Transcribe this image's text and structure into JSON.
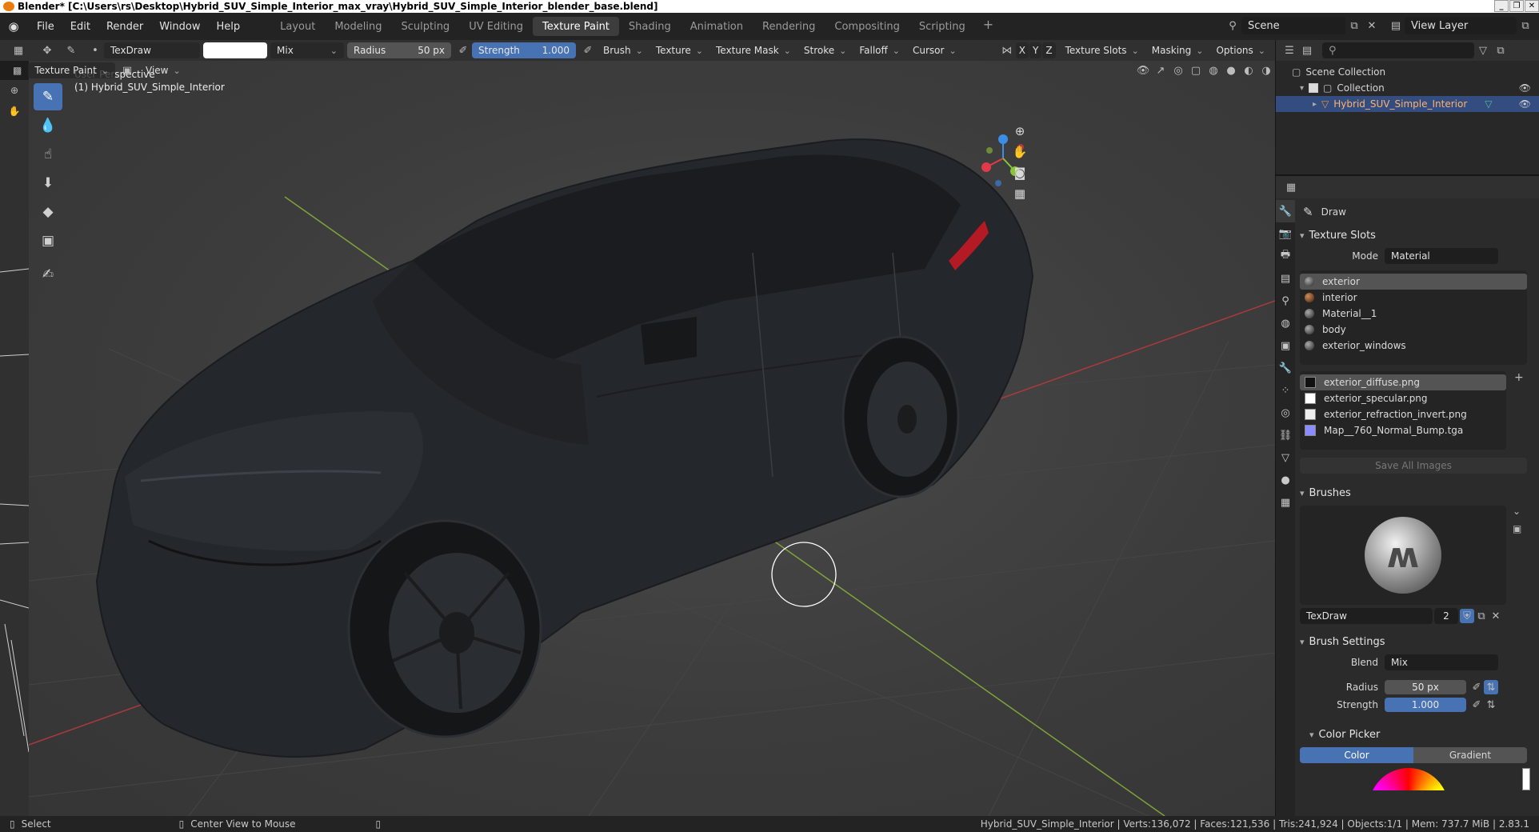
{
  "window": {
    "title": "Blender* [C:\\Users\\rs\\Desktop\\Hybrid_SUV_Simple_Interior_max_vray\\Hybrid_SUV_Simple_Interior_blender_base.blend]",
    "controls": [
      "_",
      "❐",
      "✕"
    ]
  },
  "menu": {
    "items": [
      "File",
      "Edit",
      "Render",
      "Window",
      "Help"
    ]
  },
  "workspaces": {
    "tabs": [
      "Layout",
      "Modeling",
      "Sculpting",
      "UV Editing",
      "Texture Paint",
      "Shading",
      "Animation",
      "Rendering",
      "Compositing",
      "Scripting"
    ],
    "active": "Texture Paint",
    "add": "+"
  },
  "scene": {
    "name": "Scene",
    "view_layer": "View Layer"
  },
  "tool_header": {
    "brush_name": "TexDraw",
    "blend_mode": "Mix",
    "radius_label": "Radius",
    "radius_value": "50 px",
    "strength_label": "Strength",
    "strength_value": "1.000",
    "strength_fill": 1.0,
    "dropdowns": [
      "Brush",
      "Texture",
      "Texture Mask",
      "Stroke",
      "Falloff",
      "Cursor"
    ],
    "axes": [
      "X",
      "Y",
      "Z"
    ],
    "right_dropdowns": [
      "Texture Slots",
      "Masking",
      "Options"
    ]
  },
  "sub_header": {
    "mode": "Texture Paint",
    "view": "View"
  },
  "viewport": {
    "perspective": "User Perspective",
    "object_label": "(1) Hybrid_SUV_Simple_Interior",
    "gizmo": {
      "x": "X",
      "y": "Y",
      "z": "Z"
    },
    "colors": {
      "x_axis": "#e33a49",
      "y_axis": "#8ac43a",
      "z_axis": "#3c8de8",
      "car_body": "#23262a",
      "tail_light": "#b31a24"
    }
  },
  "toolbar": {
    "tools": [
      "draw-brush-icon",
      "soften-icon",
      "smear-icon",
      "clone-icon",
      "fill-icon",
      "mask-icon",
      "annotate-icon"
    ],
    "active_index": 0
  },
  "outliner": {
    "search_placeholder": "",
    "scene_collection": "Scene Collection",
    "collection": "Collection",
    "object": "Hybrid_SUV_Simple_Interior"
  },
  "properties": {
    "tool_name": "Draw",
    "texture_slots": {
      "header": "Texture Slots",
      "mode_label": "Mode",
      "mode_value": "Material",
      "materials": [
        "exterior",
        "interior",
        "Material__1",
        "body",
        "exterior_windows"
      ],
      "selected_material": 0,
      "images": [
        "exterior_diffuse.png",
        "exterior_specular.png",
        "exterior_refraction_invert.png",
        "Map__760_Normal_Bump.tga"
      ],
      "selected_image": 0,
      "save_all": "Save All Images"
    },
    "brushes": {
      "header": "Brushes",
      "name": "TexDraw",
      "users": "2"
    },
    "brush_settings": {
      "header": "Brush Settings",
      "blend_label": "Blend",
      "blend_value": "Mix",
      "radius_label": "Radius",
      "radius_value": "50 px",
      "strength_label": "Strength",
      "strength_value": "1.000"
    },
    "color_picker": {
      "header": "Color Picker",
      "tab_color": "Color",
      "tab_gradient": "Gradient"
    }
  },
  "status": {
    "select": "Select",
    "center_view": "Center View to Mouse",
    "stats": "Hybrid_SUV_Simple_Interior | Verts:136,072 | Faces:121,536 | Tris:241,924 | Objects:1/1 | Mem: 737.7 MiB | 2.83.1"
  },
  "accent": "#4772b3"
}
